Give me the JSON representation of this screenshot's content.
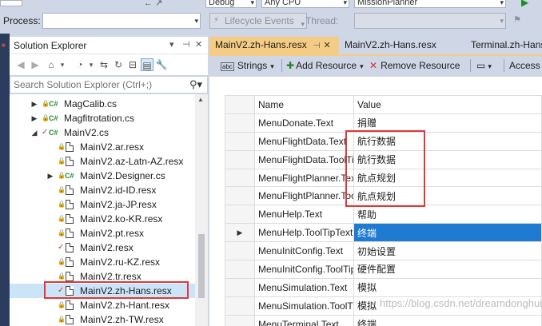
{
  "toolbar": {
    "debug": "Debug",
    "cpu": "Any CPU",
    "project": "MissionPlanner",
    "process_label": "Process:",
    "lifecycle": "Lifecycle Events",
    "thread_label": "Thread:"
  },
  "solution_explorer": {
    "title": "Solution Explorer",
    "search_placeholder": "Search Solution Explorer (Ctrl+;)",
    "items": [
      {
        "name": "MagCalib.cs"
      },
      {
        "name": "Magfitrotation.cs"
      },
      {
        "name": "MainV2.cs"
      },
      {
        "name": "MainV2.ar.resx"
      },
      {
        "name": "MainV2.az-Latn-AZ.resx"
      },
      {
        "name": "MainV2.Designer.cs"
      },
      {
        "name": "MainV2.id-ID.resx"
      },
      {
        "name": "MainV2.ja-JP.resx"
      },
      {
        "name": "MainV2.ko-KR.resx"
      },
      {
        "name": "MainV2.pt.resx"
      },
      {
        "name": "MainV2.resx"
      },
      {
        "name": "MainV2.ru-KZ.resx"
      },
      {
        "name": "MainV2.tr.resx"
      },
      {
        "name": "MainV2.zh-Hans.resx"
      },
      {
        "name": "MainV2.zh-Hant.resx"
      },
      {
        "name": "MainV2.zh-TW.resx"
      }
    ]
  },
  "tabs": [
    {
      "label": "MainV2.zh-Hans.resx"
    },
    {
      "label": "MainV2.zh-Hans.resx"
    },
    {
      "label": "Terminal.zh-Hans"
    }
  ],
  "resx_toolbar": {
    "strings": "Strings",
    "add_resource": "Add Resource",
    "remove_resource": "Remove Resource",
    "access": "Access M"
  },
  "grid": {
    "col_name": "Name",
    "col_value": "Value",
    "rows": [
      {
        "name": "MenuDonate.Text",
        "value": "捐赠"
      },
      {
        "name": "MenuFlightData.Text",
        "value": "航行数据"
      },
      {
        "name": "MenuFlightData.ToolTipText",
        "value": "航行数据"
      },
      {
        "name": "MenuFlightPlanner.Text",
        "value": "航点规划"
      },
      {
        "name": "MenuFlightPlanner.ToolTipText",
        "value": "航点规划"
      },
      {
        "name": "MenuHelp.Text",
        "value": "帮助"
      },
      {
        "name": "MenuHelp.ToolTipText",
        "value": "终端"
      },
      {
        "name": "MenuInitConfig.Text",
        "value": "初始设置"
      },
      {
        "name": "MenuInitConfig.ToolTipText",
        "value": "硬件配置"
      },
      {
        "name": "MenuSimulation.Text",
        "value": "模拟"
      },
      {
        "name": "MenuSimulation.ToolTipText",
        "value": "模拟"
      },
      {
        "name": "MenuTerminal.Text",
        "value": "终端"
      }
    ]
  },
  "watermark": "https://blog.csdn.net/dreamdonghui"
}
